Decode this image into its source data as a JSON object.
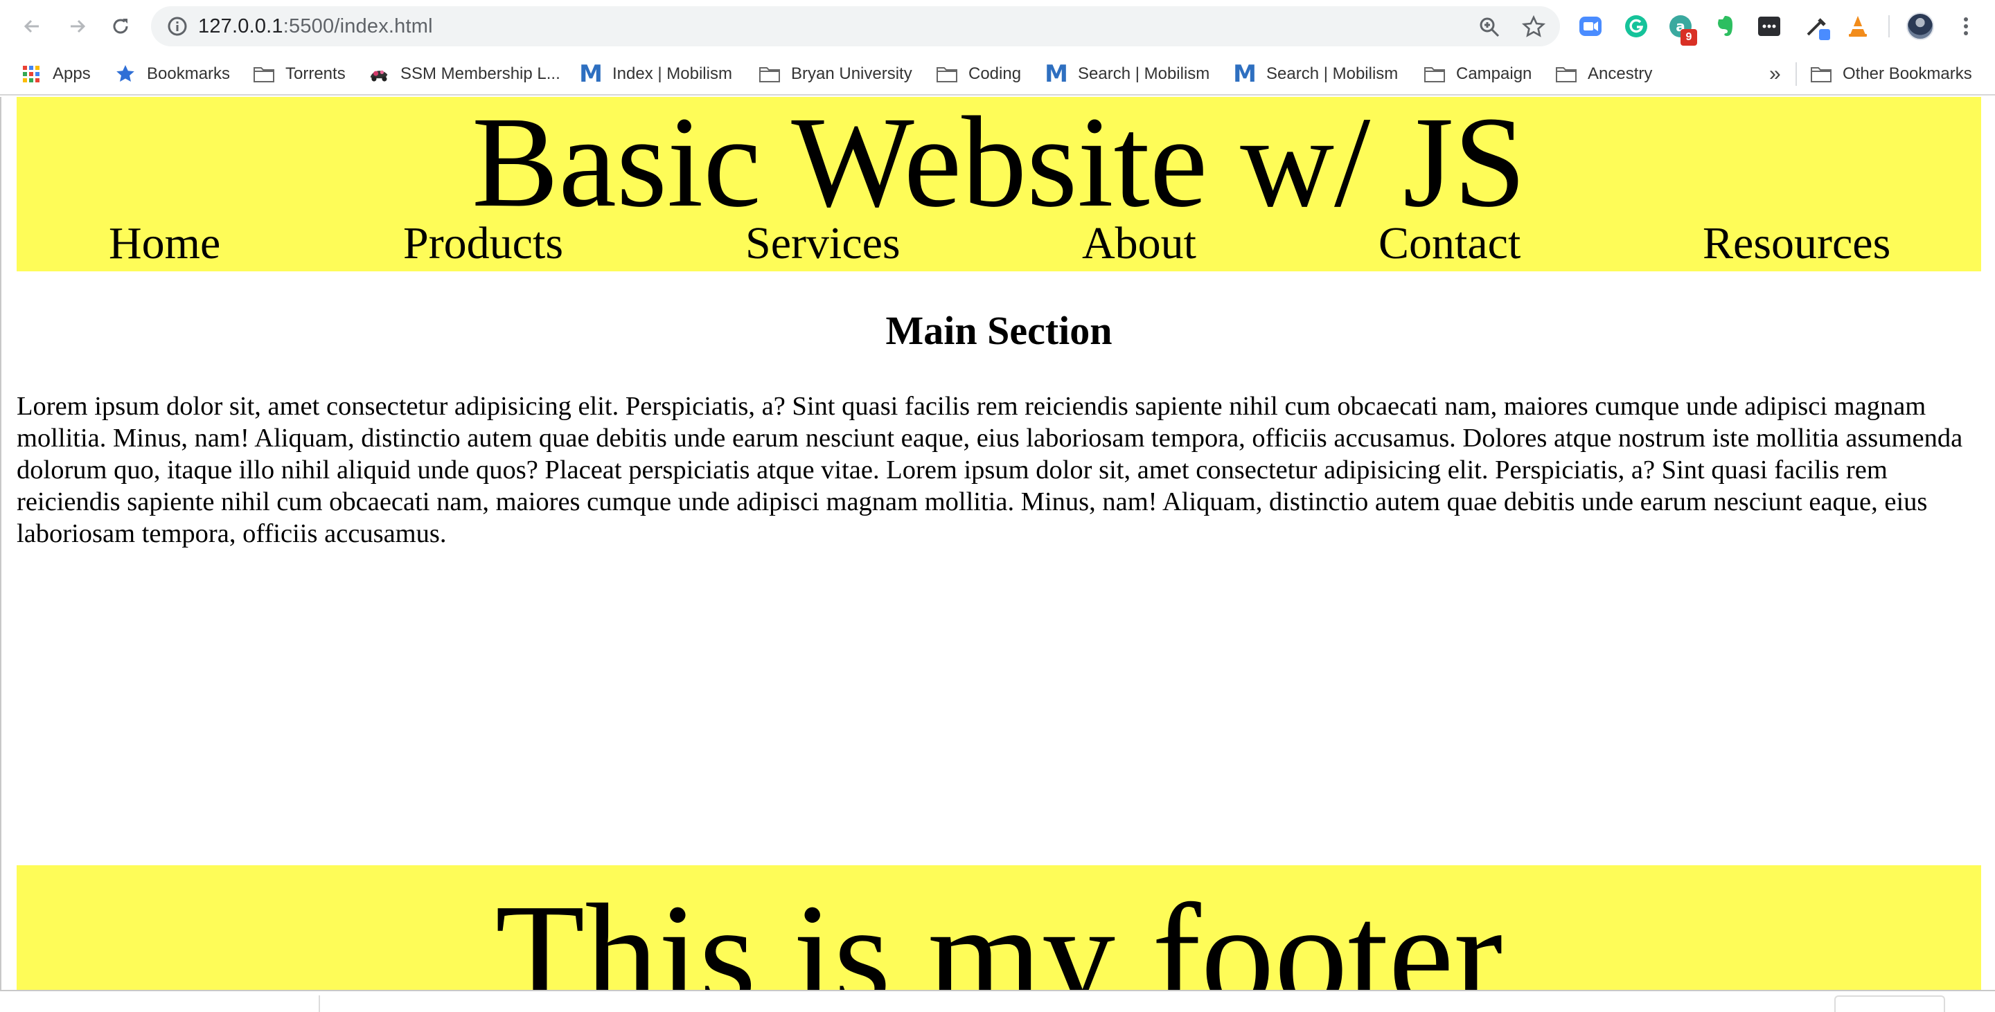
{
  "browser": {
    "url_host": "127.0.0.1",
    "url_rest": ":5500/index.html",
    "extension_badge": "9",
    "icons": [
      "back-icon",
      "forward-icon",
      "reload-icon",
      "site-info-icon",
      "zoom-icon",
      "bookmark-star-icon",
      "menu-icon"
    ]
  },
  "bookmarks": {
    "items": [
      {
        "label": "Apps",
        "icon": "apps-grid-icon"
      },
      {
        "label": "Bookmarks",
        "icon": "star-icon"
      },
      {
        "label": "Torrents",
        "icon": "folder-icon"
      },
      {
        "label": "SSM Membership L...",
        "icon": "site-icon"
      },
      {
        "label": "Index | Mobilism",
        "icon": "mobilism-icon"
      },
      {
        "label": "Bryan University",
        "icon": "folder-icon"
      },
      {
        "label": "Coding",
        "icon": "folder-icon"
      },
      {
        "label": "Search | Mobilism",
        "icon": "mobilism-icon"
      },
      {
        "label": "Search | Mobilism",
        "icon": "mobilism-icon"
      },
      {
        "label": "Campaign",
        "icon": "folder-icon"
      },
      {
        "label": "Ancestry",
        "icon": "folder-icon"
      }
    ],
    "overflow": "»",
    "other": "Other Bookmarks"
  },
  "page": {
    "title": "Basic Website w/ JS",
    "nav": [
      "Home",
      "Products",
      "Services",
      "About",
      "Contact",
      "Resources"
    ],
    "main_heading": "Main Section",
    "main_text": "Lorem ipsum dolor sit, amet consectetur adipisicing elit. Perspiciatis, a? Sint quasi facilis rem reiciendis sapiente nihil cum obcaecati nam, maiores cumque unde adipisci magnam mollitia. Minus, nam! Aliquam, distinctio autem quae debitis unde earum nesciunt eaque, eius laboriosam tempora, officiis accusamus. Dolores atque nostrum iste mollitia assumenda dolorum quo, itaque illo nihil aliquid unde quos? Placeat perspiciatis atque vitae. Lorem ipsum dolor sit, amet consectetur adipisicing elit. Perspiciatis, a? Sint quasi facilis rem reiciendis sapiente nihil cum obcaecati nam, maiores cumque unde adipisci magnam mollitia. Minus, nam! Aliquam, distinctio autem quae debitis unde earum nesciunt eaque, eius laboriosam tempora, officiis accusamus.",
    "footer": "This is my footer",
    "header_color": "#fefc58"
  }
}
